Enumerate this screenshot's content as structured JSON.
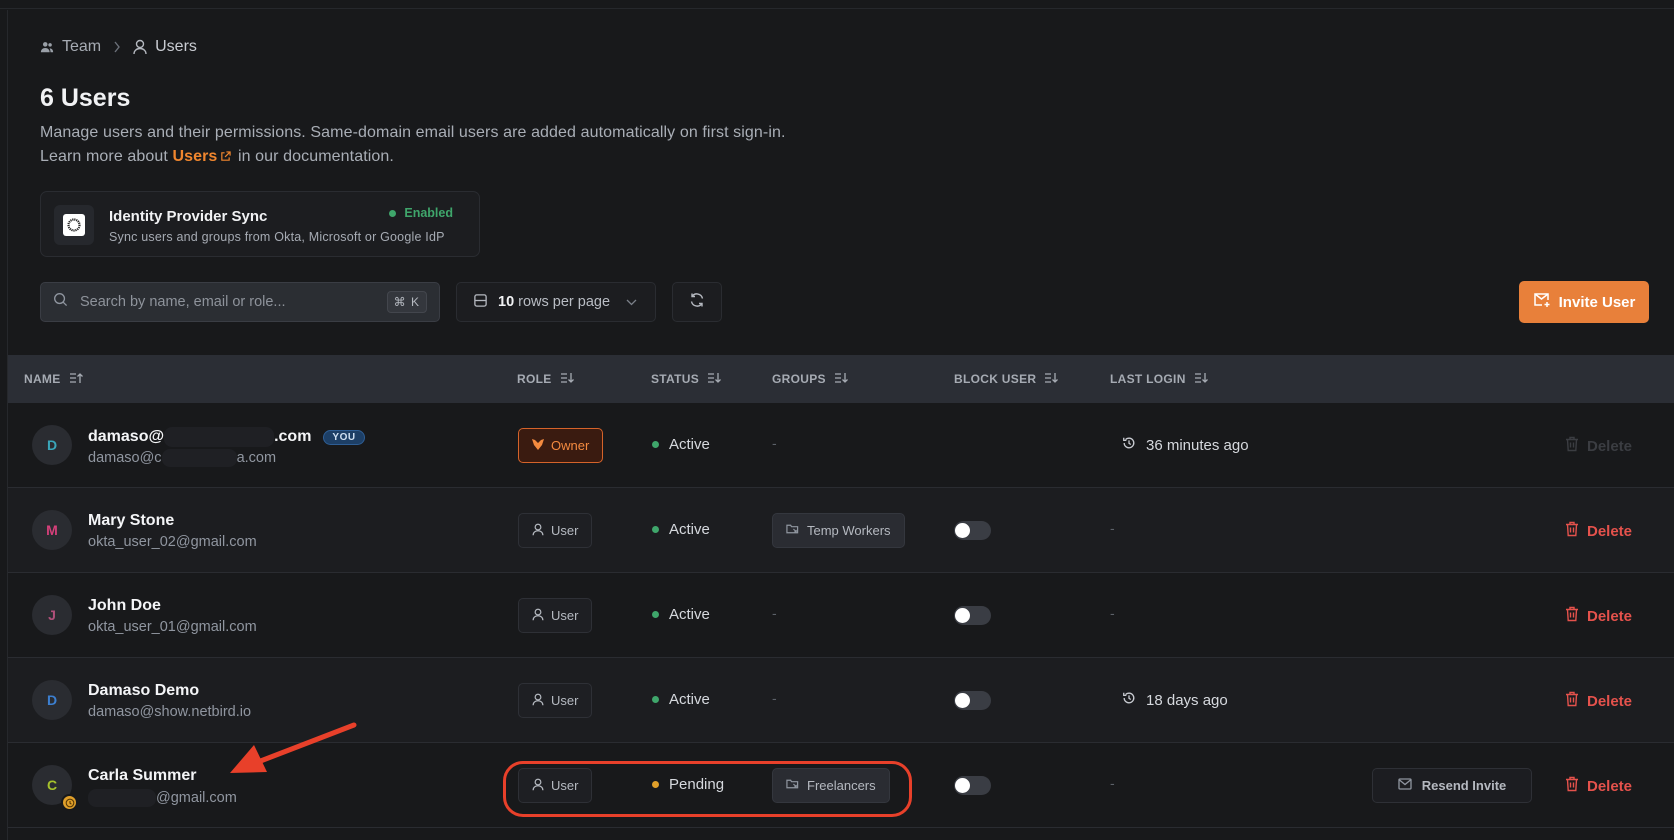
{
  "breadcrumb": {
    "parent": "Team",
    "current": "Users"
  },
  "header": {
    "title": "6 Users",
    "description_line1": "Manage users and their permissions. Same-domain email users are added automatically on first sign-in.",
    "description_pre": "Learn more about",
    "description_link": "Users",
    "description_post": "in our documentation."
  },
  "idp_card": {
    "title": "Identity Provider Sync",
    "subtitle": "Sync users and groups from Okta, Microsoft or Google IdP",
    "status": "Enabled",
    "status_color": "#3fa66b"
  },
  "toolbar": {
    "search_placeholder": "Search by name, email or role...",
    "search_value": "",
    "search_shortcut": "⌘ K",
    "rows_per_page_value": "10",
    "rows_per_page_label": "rows per page",
    "invite_label": "Invite User",
    "accent_color": "#e8803a"
  },
  "table": {
    "columns": [
      {
        "label": "NAME",
        "sort_icon": "sort-ascending-icon"
      },
      {
        "label": "ROLE",
        "sort_icon": "sort-descending-icon"
      },
      {
        "label": "STATUS",
        "sort_icon": "sort-descending-icon"
      },
      {
        "label": "GROUPS",
        "sort_icon": "sort-descending-icon"
      },
      {
        "label": "BLOCK USER",
        "sort_icon": "sort-descending-icon"
      },
      {
        "label": "LAST LOGIN",
        "sort_icon": "sort-descending-icon"
      }
    ],
    "rows": [
      {
        "initial": "D",
        "initial_color": "#3aa6b9",
        "name_pre": "damaso@",
        "name_post": ".com",
        "email_pre": "damaso@c",
        "email_post": "a.com",
        "you_badge": "YOU",
        "role": "Owner",
        "status": "Active",
        "status_color": "#3fa66b",
        "groups": "-",
        "block_user": null,
        "last_login": "36 minutes ago",
        "delete_label": "Delete",
        "delete_enabled": false
      },
      {
        "initial": "M",
        "initial_color": "#d6407a",
        "name": "Mary Stone",
        "email": "okta_user_02@gmail.com",
        "role": "User",
        "status": "Active",
        "status_color": "#3fa66b",
        "groups": "Temp Workers",
        "block_user": false,
        "last_login": "-",
        "delete_label": "Delete",
        "delete_enabled": true
      },
      {
        "initial": "J",
        "initial_color": "#b0507a",
        "name": "John Doe",
        "email": "okta_user_01@gmail.com",
        "role": "User",
        "status": "Active",
        "status_color": "#3fa66b",
        "groups": "-",
        "block_user": false,
        "last_login": "-",
        "delete_label": "Delete",
        "delete_enabled": true
      },
      {
        "initial": "D",
        "initial_color": "#3c7fd0",
        "name": "Damaso Demo",
        "email": "damaso@show.netbird.io",
        "role": "User",
        "status": "Active",
        "status_color": "#3fa66b",
        "groups": "-",
        "block_user": false,
        "last_login": "18 days ago",
        "delete_label": "Delete",
        "delete_enabled": true
      },
      {
        "initial": "C",
        "initial_color": "#a6c22c",
        "name": "Carla Summer",
        "email_post": "gmail.com",
        "pending_badge": true,
        "role": "User",
        "status": "Pending",
        "status_color": "#e0a02a",
        "groups": "Freelancers",
        "block_user": false,
        "last_login": "-",
        "resend_label": "Resend Invite",
        "delete_label": "Delete",
        "delete_enabled": true
      }
    ]
  },
  "annotation": {
    "color": "#e8402a",
    "highlight": "Carla Summer row: role, status and groups"
  }
}
